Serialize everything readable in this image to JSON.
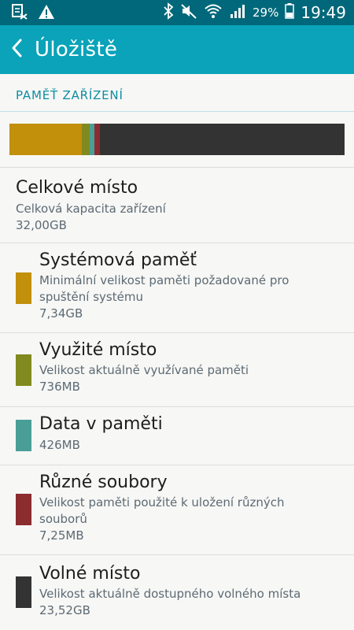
{
  "status_bar": {
    "battery_percent": "29%",
    "time": "19:49",
    "icons": [
      "screenshot-notification-icon",
      "warning-icon",
      "bluetooth-icon",
      "mute-icon",
      "wifi-icon",
      "signal-icon",
      "battery-icon"
    ]
  },
  "app_bar": {
    "title": "Úložiště",
    "back_icon": "chevron-left-icon"
  },
  "section": {
    "header": "PAMĚŤ ZAŘÍZENÍ"
  },
  "usage_bar": {
    "segments": [
      {
        "name": "system",
        "value_gb": 7.34,
        "color": "#c2900b"
      },
      {
        "name": "used",
        "value_gb": 0.736,
        "color": "#808a1e"
      },
      {
        "name": "cached",
        "value_gb": 0.426,
        "color": "#4a9e98"
      },
      {
        "name": "misc",
        "value_gb": 0.00725,
        "color": "#8b2c2f"
      },
      {
        "name": "free",
        "value_gb": 23.52,
        "color": "#333333"
      }
    ]
  },
  "total": {
    "title": "Celkové místo",
    "subtitle": "Celková kapacita zařízení",
    "value": "32,00GB"
  },
  "items": [
    {
      "title": "Systémová paměť",
      "subtitle_line1": "Minimální velikost paměti požadované pro",
      "subtitle_line2": "spuštění systému",
      "value": "7,34GB",
      "color": "#c2900b"
    },
    {
      "title": "Využité místo",
      "subtitle_line1": "Velikost aktuálně využívané paměti",
      "subtitle_line2": "",
      "value": "736MB",
      "color": "#808a1e"
    },
    {
      "title": "Data v paměti",
      "subtitle_line1": "",
      "subtitle_line2": "",
      "value": "426MB",
      "color": "#4a9e98"
    },
    {
      "title": "Různé soubory",
      "subtitle_line1": "Velikost paměti použité k uložení různých",
      "subtitle_line2": "souborů",
      "value": "7,25MB",
      "color": "#8b2c2f"
    },
    {
      "title": "Volné místo",
      "subtitle_line1": "Velikost aktuálně dostupného volného místa",
      "subtitle_line2": "",
      "value": "23,52GB",
      "color": "#333333"
    }
  ]
}
